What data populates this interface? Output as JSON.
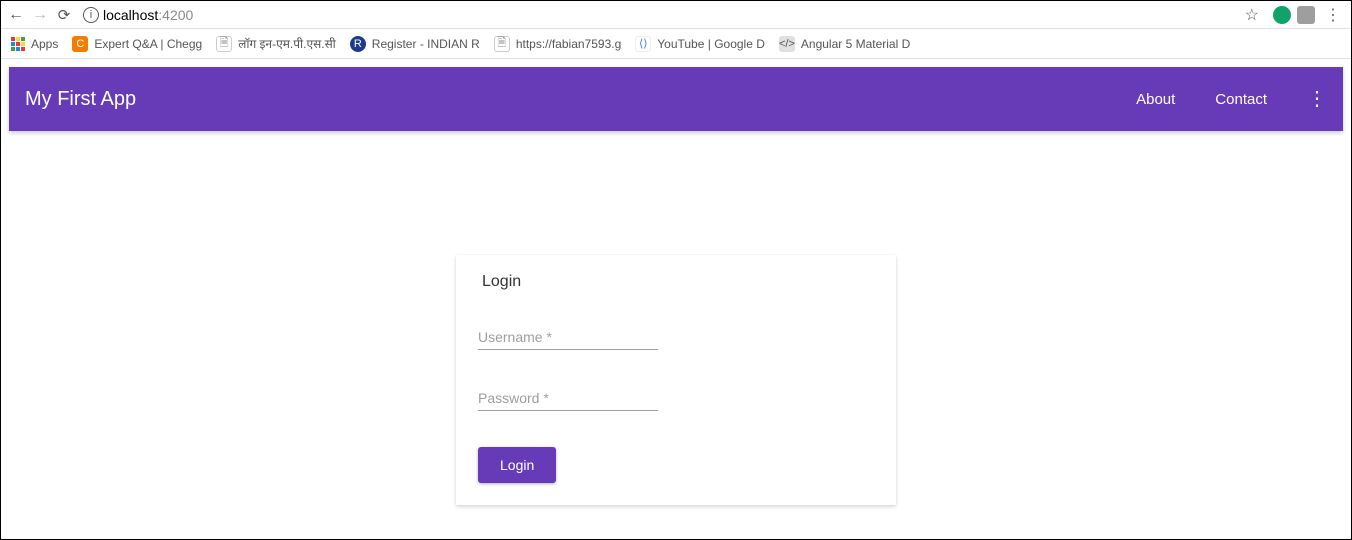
{
  "browser": {
    "url_host": "localhost",
    "url_port": ":4200",
    "bookmarks": {
      "apps": "Apps",
      "items": [
        {
          "label": "Expert Q&A | Chegg",
          "icon_bg": "#f57c00",
          "icon_text": "C"
        },
        {
          "label": "लॉग इन-एम.पी.एस.सी",
          "icon_bg": "#f5f5f5",
          "icon_text": "🗎"
        },
        {
          "label": "Register - INDIAN R",
          "icon_bg": "#1e3a8a",
          "icon_text": "R"
        },
        {
          "label": "https://fabian7593.g",
          "icon_bg": "#f5f5f5",
          "icon_text": "🗎"
        },
        {
          "label": "YouTube  |  Google D",
          "icon_bg": "#ffffff",
          "icon_text": "⟨⟩"
        },
        {
          "label": "Angular 5 Material D",
          "icon_bg": "#e0e0e0",
          "icon_text": "</>"
        }
      ]
    }
  },
  "header": {
    "title": "My First App",
    "nav": {
      "about": "About",
      "contact": "Contact"
    }
  },
  "login": {
    "title": "Login",
    "username_placeholder": "Username *",
    "password_placeholder": "Password *",
    "button": "Login"
  }
}
